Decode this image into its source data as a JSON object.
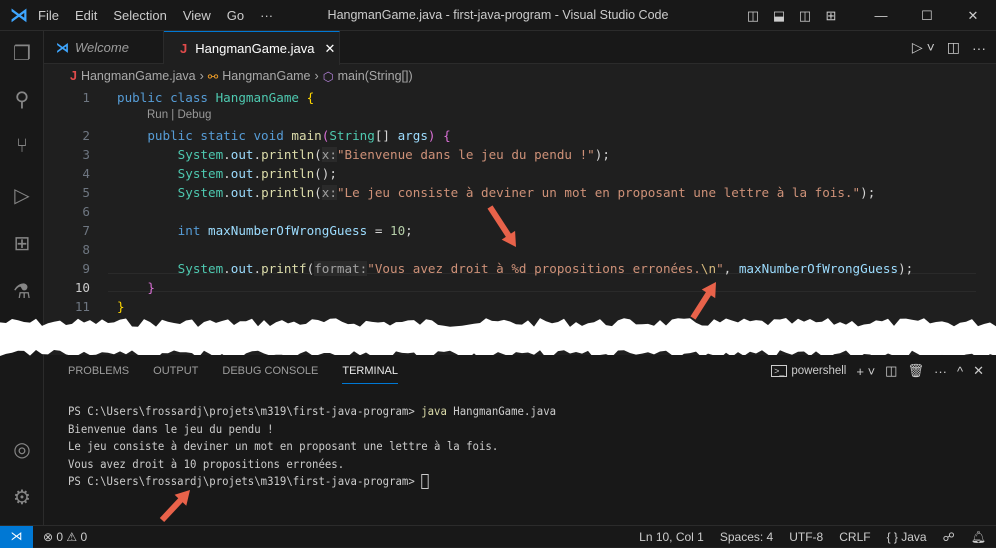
{
  "window": {
    "title": "HangmanGame.java - first-java-program - Visual Studio Code",
    "menu": [
      "File",
      "Edit",
      "Selection",
      "View",
      "Go",
      "···"
    ]
  },
  "tabs": [
    {
      "label": "Welcome",
      "icon": "vscode-icon"
    },
    {
      "label": "HangmanGame.java",
      "icon": "java-icon",
      "active": true
    }
  ],
  "breadcrumb": [
    "HangmanGame.java",
    "HangmanGame",
    "main(String[])"
  ],
  "codelens": "Run | Debug",
  "code": [
    {
      "n": "1",
      "tokens": [
        [
          "k",
          "public class "
        ],
        [
          "t",
          "HangmanGame "
        ],
        [
          "b1",
          "{"
        ]
      ]
    },
    {
      "n": "2",
      "tokens": [
        [
          "k",
          "    public static void "
        ],
        [
          "f",
          "main"
        ],
        [
          "b2",
          "("
        ],
        [
          "t",
          "String"
        ],
        [
          "p",
          "[] "
        ],
        [
          "v",
          "args"
        ],
        [
          "b2",
          ")"
        ],
        [
          "p",
          " "
        ],
        [
          "b2",
          "{"
        ]
      ]
    },
    {
      "n": "3",
      "tokens": [
        [
          "t",
          "        System"
        ],
        [
          "p",
          "."
        ],
        [
          "v",
          "out"
        ],
        [
          "p",
          "."
        ],
        [
          "f",
          "println"
        ],
        [
          "p",
          "("
        ],
        [
          "h",
          "x:"
        ],
        [
          "s",
          "\"Bienvenue dans le jeu du pendu !\""
        ],
        [
          "p",
          ");"
        ]
      ]
    },
    {
      "n": "4",
      "tokens": [
        [
          "t",
          "        System"
        ],
        [
          "p",
          "."
        ],
        [
          "v",
          "out"
        ],
        [
          "p",
          "."
        ],
        [
          "f",
          "println"
        ],
        [
          "p",
          "();"
        ]
      ]
    },
    {
      "n": "5",
      "tokens": [
        [
          "t",
          "        System"
        ],
        [
          "p",
          "."
        ],
        [
          "v",
          "out"
        ],
        [
          "p",
          "."
        ],
        [
          "f",
          "println"
        ],
        [
          "p",
          "("
        ],
        [
          "h",
          "x:"
        ],
        [
          "s",
          "\"Le jeu consiste à deviner un mot en proposant une lettre à la fois.\""
        ],
        [
          "p",
          ");"
        ]
      ]
    },
    {
      "n": "6",
      "tokens": []
    },
    {
      "n": "7",
      "tokens": [
        [
          "k",
          "        int "
        ],
        [
          "v",
          "maxNumberOfWrongGuess"
        ],
        [
          "p",
          " = "
        ],
        [
          "n",
          "10"
        ],
        [
          "p",
          ";"
        ]
      ]
    },
    {
      "n": "8",
      "tokens": []
    },
    {
      "n": "9",
      "tokens": [
        [
          "t",
          "        System"
        ],
        [
          "p",
          "."
        ],
        [
          "v",
          "out"
        ],
        [
          "p",
          "."
        ],
        [
          "f",
          "printf"
        ],
        [
          "p",
          "("
        ],
        [
          "h",
          "format:"
        ],
        [
          "s",
          "\"Vous avez droit à %d propositions erronées."
        ],
        [
          "e",
          "\\n"
        ],
        [
          "s",
          "\""
        ],
        [
          "p",
          ", "
        ],
        [
          "v",
          "maxNumberOfWrongGuess"
        ],
        [
          "p",
          ");"
        ]
      ]
    },
    {
      "n": "10",
      "tokens": [
        [
          "b2",
          "    }"
        ]
      ]
    },
    {
      "n": "11",
      "tokens": [
        [
          "b1",
          "}"
        ]
      ]
    }
  ],
  "panel": {
    "tabs": [
      "PROBLEMS",
      "OUTPUT",
      "DEBUG CONSOLE",
      "TERMINAL"
    ],
    "active": "TERMINAL",
    "shell": "powershell"
  },
  "terminal": {
    "prompt": "PS C:\\Users\\frossardj\\projets\\m319\\first-java-program> ",
    "command": "java",
    "args": " HangmanGame.java",
    "output": [
      "Bienvenue dans le jeu du pendu !",
      "",
      "Le jeu consiste à deviner un mot en proposant une lettre à la fois.",
      "Vous avez droit à 10 propositions erronées."
    ],
    "prompt2": "PS C:\\Users\\frossardj\\projets\\m319\\first-java-program> "
  },
  "status": {
    "problems": "⊗ 0 ⚠ 0",
    "position": "Ln 10, Col 1",
    "spaces": "Spaces: 4",
    "encoding": "UTF-8",
    "eol": "CRLF",
    "language": "{ } Java"
  },
  "colors": {
    "accent": "#0078d4",
    "annotation_arrow": "#e8624a"
  }
}
